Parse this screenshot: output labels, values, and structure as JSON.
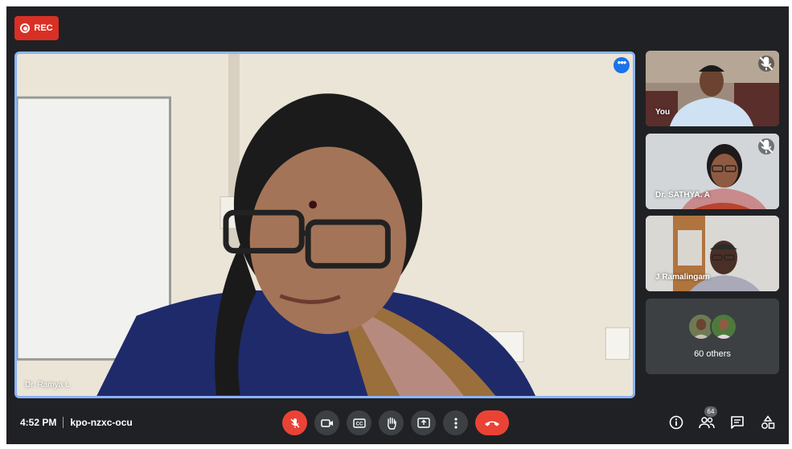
{
  "recording": {
    "label": "REC"
  },
  "main": {
    "speaker_name": "Dr. Ramya L"
  },
  "participants": [
    {
      "name": "You",
      "muted": true
    },
    {
      "name": "Dr. SATHYA. A",
      "muted": true
    },
    {
      "name": "J Ramalingam",
      "muted": false
    }
  ],
  "others": {
    "label": "60 others"
  },
  "bottom": {
    "time": "4:52 PM",
    "meeting_code": "kpo-nzxc-ocu",
    "people_count": "64"
  },
  "colors": {
    "background": "#202124",
    "accent": "#1a73e8",
    "danger": "#ea4335",
    "button": "#3c4043"
  }
}
